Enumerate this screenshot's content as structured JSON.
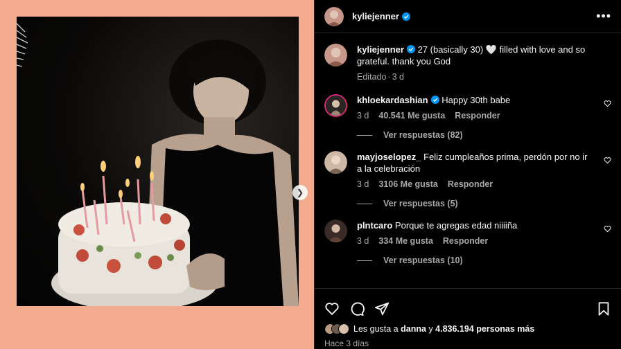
{
  "post": {
    "author": "kyliejenner",
    "caption": "27 (basically 30) 🤍 filled with love and so grateful. thank you God",
    "edited_label": "Editado",
    "caption_age": "3 d"
  },
  "comments": [
    {
      "username": "khloekardashian",
      "verified": true,
      "text": "Happy 30th babe",
      "age": "3 d",
      "likes": "40.541 Me gusta",
      "reply_label": "Responder",
      "view_replies": "Ver respuestas (82)"
    },
    {
      "username": "mayjoselopez_",
      "verified": false,
      "text": "Feliz cumpleaños prima, perdón por no ir a la celebración",
      "age": "3 d",
      "likes": "3106 Me gusta",
      "reply_label": "Responder",
      "view_replies": "Ver respuestas (5)"
    },
    {
      "username": "plntcaro",
      "verified": false,
      "text": "Porque te agregas edad niiiiña",
      "age": "3 d",
      "likes": "334 Me gusta",
      "reply_label": "Responder",
      "view_replies": "Ver respuestas (10)"
    }
  ],
  "likes_summary": {
    "prefix": "Les gusta a",
    "user": "danna",
    "connector": "y",
    "count": "4.836.194 personas más"
  },
  "timestamp": "Hace 3 días",
  "icons": {
    "more": "more-options-icon",
    "like": "heart-icon",
    "comment": "comment-icon",
    "share": "share-icon",
    "save": "bookmark-icon",
    "next": "chevron-right-icon",
    "verified": "verified-badge-icon"
  },
  "colors": {
    "background": "#000000",
    "media_backdrop": "#f2ab8c",
    "verified": "#0095f6",
    "secondary_text": "#a8a8a8"
  }
}
